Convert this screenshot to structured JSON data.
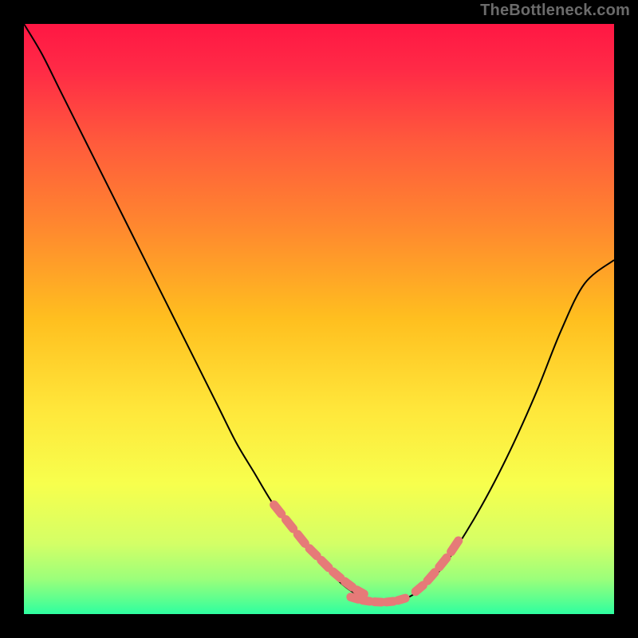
{
  "watermark": "TheBottleneck.com",
  "chart_data": {
    "type": "line",
    "title": "",
    "xlabel": "",
    "ylabel": "",
    "xlim": [
      0,
      100
    ],
    "ylim": [
      0,
      100
    ],
    "series": [
      {
        "name": "bottleneck-curve",
        "x": [
          0,
          3,
          6,
          9,
          12,
          15,
          18,
          21,
          24,
          27,
          30,
          33,
          36,
          39,
          42,
          45,
          48,
          51,
          54,
          57,
          60,
          63,
          67,
          71,
          75,
          79,
          83,
          87,
          91,
          95,
          100
        ],
        "values": [
          100,
          95,
          89,
          83,
          77,
          71,
          65,
          59,
          53,
          47,
          41,
          35,
          29,
          24,
          19,
          15,
          11,
          8,
          5,
          3,
          2,
          2,
          4,
          8,
          14,
          21,
          29,
          38,
          48,
          56,
          60
        ]
      },
      {
        "name": "highlight-left",
        "x": [
          42,
          44,
          46,
          48,
          50,
          52,
          54,
          56,
          58
        ],
        "values": [
          19,
          16.5,
          14,
          11.5,
          9.5,
          7.5,
          5.8,
          4.3,
          3.2
        ]
      },
      {
        "name": "highlight-bottom",
        "x": [
          55,
          57,
          59,
          61,
          63,
          65
        ],
        "values": [
          3.0,
          2.4,
          2.1,
          2.0,
          2.2,
          2.8
        ]
      },
      {
        "name": "highlight-right",
        "x": [
          66,
          68,
          70,
          72,
          74
        ],
        "values": [
          3.5,
          5.2,
          7.5,
          10.0,
          13.0
        ]
      }
    ],
    "gradient_stops": [
      {
        "offset": 0.0,
        "color": "#ff1744"
      },
      {
        "offset": 0.08,
        "color": "#ff2b46"
      },
      {
        "offset": 0.2,
        "color": "#ff5a3c"
      },
      {
        "offset": 0.35,
        "color": "#ff8a2e"
      },
      {
        "offset": 0.5,
        "color": "#ffbf1f"
      },
      {
        "offset": 0.65,
        "color": "#ffe63a"
      },
      {
        "offset": 0.78,
        "color": "#f7ff4d"
      },
      {
        "offset": 0.88,
        "color": "#d4ff66"
      },
      {
        "offset": 0.94,
        "color": "#9cff7a"
      },
      {
        "offset": 0.975,
        "color": "#5dff8f"
      },
      {
        "offset": 1.0,
        "color": "#2effa0"
      }
    ],
    "highlight_color": "#e67a78",
    "curve_color": "#000000"
  }
}
